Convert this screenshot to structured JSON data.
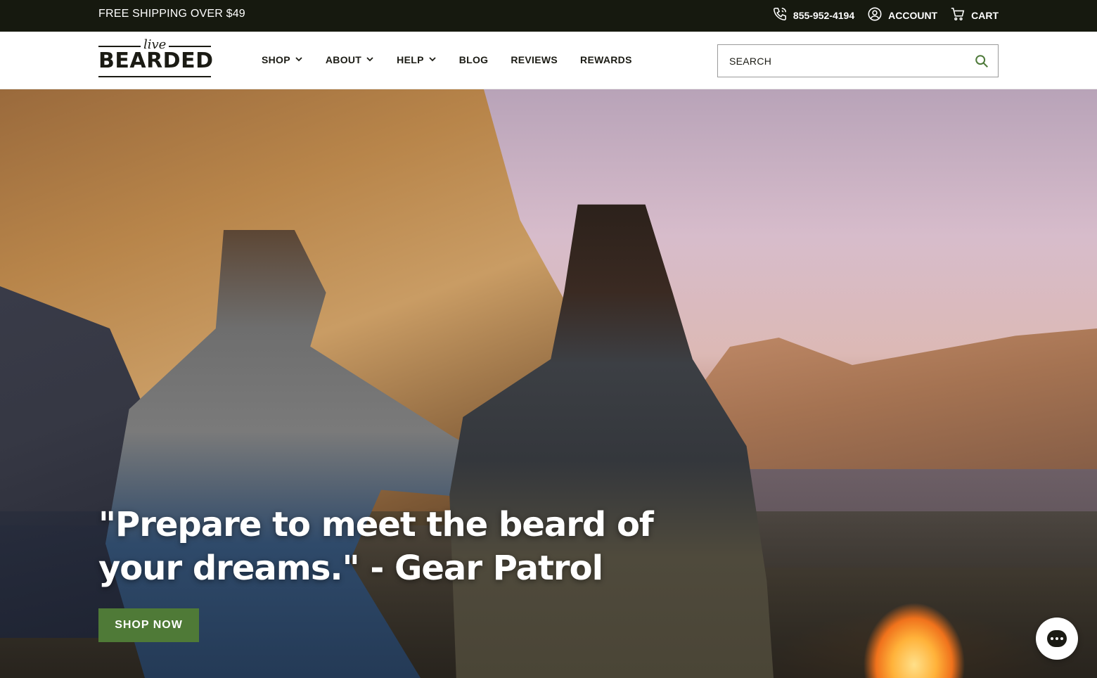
{
  "announcement": {
    "promo": "FREE SHIPPING OVER $49",
    "phone": "855-952-4194",
    "account_label": "ACCOUNT",
    "cart_label": "CART"
  },
  "header": {
    "logo_script": "live",
    "logo_word": "BEARDED",
    "nav": [
      {
        "label": "SHOP",
        "has_dropdown": true
      },
      {
        "label": "ABOUT",
        "has_dropdown": true
      },
      {
        "label": "HELP",
        "has_dropdown": true
      },
      {
        "label": "BLOG",
        "has_dropdown": false
      },
      {
        "label": "REVIEWS",
        "has_dropdown": false
      },
      {
        "label": "REWARDS",
        "has_dropdown": false
      }
    ],
    "search": {
      "placeholder": "SEARCH",
      "value": ""
    }
  },
  "hero": {
    "quote": "\"Prepare to meet the beard of your dreams.\" - Gear Patrol",
    "cta_label": "SHOP NOW"
  },
  "icons": {
    "phone": "phone-icon",
    "account": "account-icon",
    "cart": "cart-icon",
    "search": "search-icon",
    "chevron": "chevron-down-icon",
    "chat": "chat-icon"
  },
  "colors": {
    "topbar_bg": "#16190f",
    "brand_text": "#1b1b14",
    "accent_green": "#4f7a37",
    "search_icon": "#4e7a3a"
  }
}
